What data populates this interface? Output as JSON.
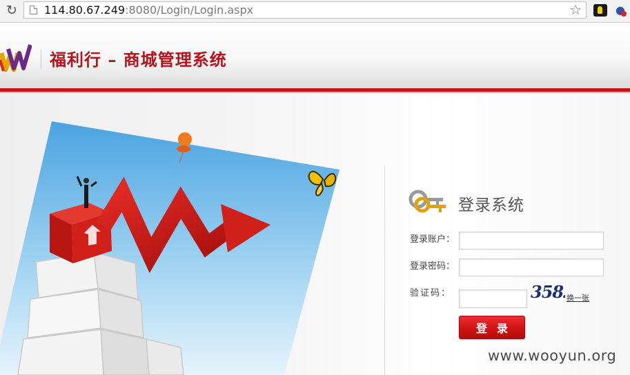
{
  "browser": {
    "url_host": "114.80.67.249",
    "url_rest": ":8080/Login/Login.aspx",
    "icons": [
      "reload-icon",
      "page-icon",
      "bookmark-star-icon",
      "extension-icon",
      "extension-icon-2"
    ]
  },
  "header": {
    "title": "福利行 – 商城管理系统",
    "accent_color": "#c0161e"
  },
  "login": {
    "title": "登录系统",
    "account_label": "登录账户：",
    "password_label": "登录密码：",
    "captcha_label": "验证码：",
    "account_value": "",
    "password_value": "",
    "captcha_value": "",
    "captcha_image_text": "3582",
    "captcha_refresh": "换一张",
    "submit_label": "登录"
  },
  "watermark": "www.wooyun.org"
}
